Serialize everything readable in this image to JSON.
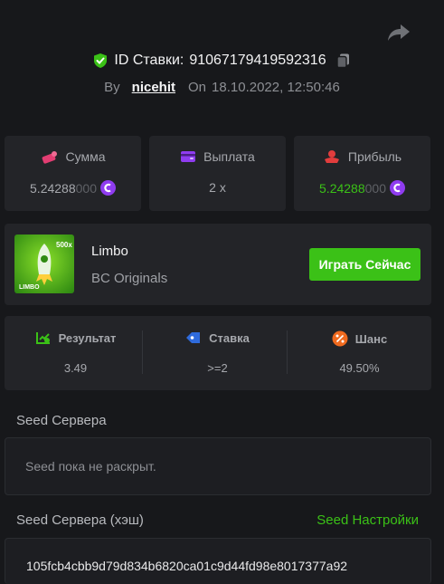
{
  "header": {
    "id_label": "ID Ставки:",
    "bet_id": "91067179419592316",
    "by_label": "By",
    "username": "nicehit",
    "on_label": "On",
    "datetime": "18.10.2022, 12:50:46"
  },
  "stats": {
    "amount": {
      "label": "Сумма",
      "value_main": "5.24288",
      "value_dim": "000"
    },
    "payout": {
      "label": "Выплата",
      "value": "2 x"
    },
    "profit": {
      "label": "Прибыль",
      "value_main": "5.24288",
      "value_dim": "000"
    }
  },
  "game": {
    "thumb_badge": "500x",
    "thumb_title": "LIMBO",
    "name": "Limbo",
    "provider": "BC Originals",
    "play_label": "Играть Сейчас"
  },
  "results": {
    "result": {
      "label": "Результат",
      "value": "3.49"
    },
    "bet": {
      "label": "Ставка",
      "value": ">=2"
    },
    "chance": {
      "label": "Шанс",
      "value": "49.50%"
    }
  },
  "server_seed": {
    "title": "Seed Сервера",
    "placeholder_text": "Seed пока не раскрыт."
  },
  "server_seed_hash": {
    "title": "Seed Сервера (хэш)",
    "settings_link": "Seed Настройки",
    "hash": "105fcb4cbb9d79d834b6820ca01c9d44fd98e8017377a92"
  },
  "colors": {
    "accent_green": "#3bc117",
    "coin_purple": "#8f3cf0",
    "panel": "#232428",
    "background": "#17181b"
  },
  "icons": {
    "share": "share-arrow-icon",
    "verified": "shield-check-icon",
    "copy": "copy-icon",
    "amount": "bet-amount-icon",
    "payout": "wallet-icon",
    "profit": "profit-icon",
    "coin": "coin-icon",
    "result": "chart-check-icon",
    "bet": "tag-icon",
    "chance": "percent-icon"
  }
}
